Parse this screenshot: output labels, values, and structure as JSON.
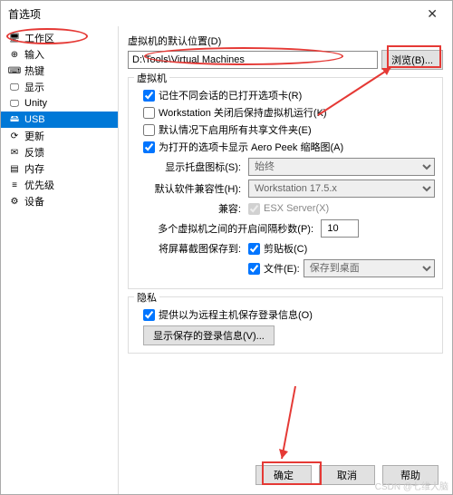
{
  "title": "首选项",
  "sidebar": {
    "items": [
      {
        "icon": "🖥",
        "label": "工作区"
      },
      {
        "icon": "⊕",
        "label": "输入"
      },
      {
        "icon": "⌨",
        "label": "热键"
      },
      {
        "icon": "🖵",
        "label": "显示"
      },
      {
        "icon": "🖵",
        "label": "Unity"
      },
      {
        "icon": "🖴",
        "label": "USB"
      },
      {
        "icon": "⟳",
        "label": "更新"
      },
      {
        "icon": "✉",
        "label": "反馈"
      },
      {
        "icon": "▤",
        "label": "内存"
      },
      {
        "icon": "≡",
        "label": "优先级"
      },
      {
        "icon": "⚙",
        "label": "设备"
      }
    ]
  },
  "defaultLocation": {
    "label": "虚拟机的默认位置(D)",
    "path": "D:\\Tools\\Virtual Machines",
    "browse": "浏览(B)..."
  },
  "vm": {
    "title": "虚拟机",
    "chk1": "记住不同会话的已打开选项卡(R)",
    "chk2": "Workstation 关闭后保持虚拟机运行(K)",
    "chk3": "默认情况下启用所有共享文件夹(E)",
    "chk4": "为打开的选项卡显示 Aero Peek 缩略图(A)",
    "trayLabel": "显示托盘图标(S):",
    "traySel": "始终",
    "compatLabel": "默认软件兼容性(H):",
    "compatSel": "Workstation 17.5.x",
    "compat2Label": "兼容:",
    "esxLabel": "ESX Server(X)",
    "multiLabel": "多个虚拟机之间的开启间隔秒数(P):",
    "multiVal": "10",
    "screenshotLabel": "将屏幕截图保存到:",
    "clipLabel": "剪贴板(C)",
    "fileLabel": "文件(E):",
    "fileSel": "保存到桌面"
  },
  "privacy": {
    "title": "隐私",
    "chk": "提供以为远程主机保存登录信息(O)",
    "btn": "显示保存的登录信息(V)..."
  },
  "footer": {
    "ok": "确定",
    "cancel": "取消",
    "help": "帮助"
  },
  "watermark": "CSDN @七维大脑"
}
